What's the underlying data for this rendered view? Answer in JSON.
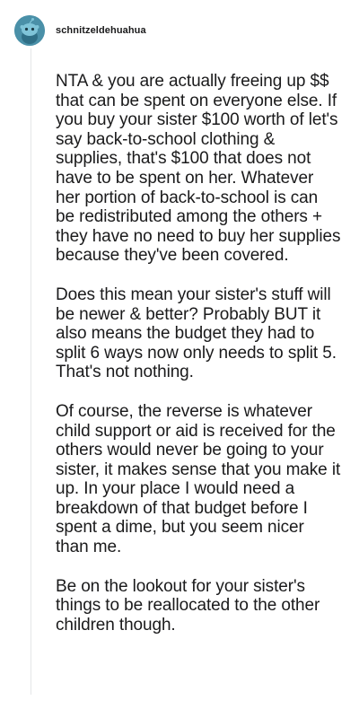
{
  "comment": {
    "username": "schnitzeldehuahua",
    "avatar_icon": "reddit-snoo-avatar-icon",
    "avatar_color": "#4a90a8",
    "paragraphs": [
      "NTA & you are actually freeing up $$ that can be spent on everyone else. If you buy your sister $100 worth of let's say back-to-school clothing & supplies, that's $100 that does not have to be spent on her. Whatever her portion of back-to-school is can be redistributed among the others + they have no need to buy her supplies because they've been covered.",
      "Does this mean your sister's stuff will be newer & better? Probably BUT it also means the budget they had to split 6 ways now only needs to split 5. That's not nothing.",
      "Of course, the reverse is whatever child support or aid is received for the others would never be going to your sister, it makes sense that you make it up. In your place I would need a breakdown of that budget before I spent a dime, but you seem nicer than me.",
      "Be on the lookout for your sister's things to be reallocated to the other children though."
    ]
  }
}
